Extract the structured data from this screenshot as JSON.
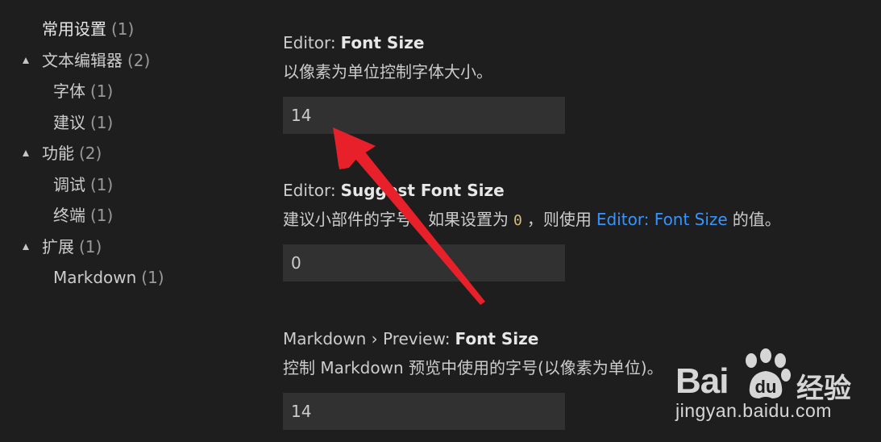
{
  "toc": {
    "items": [
      {
        "label": "常用设置",
        "count": "(1)",
        "expanded": false
      },
      {
        "label": "文本编辑器",
        "count": "(2)",
        "expanded": true
      },
      {
        "label": "字体",
        "count": "(1)"
      },
      {
        "label": "建议",
        "count": "(1)"
      },
      {
        "label": "功能",
        "count": "(2)",
        "expanded": true
      },
      {
        "label": "调试",
        "count": "(1)"
      },
      {
        "label": "终端",
        "count": "(1)"
      },
      {
        "label": "扩展",
        "count": "(1)",
        "expanded": true
      },
      {
        "label": "Markdown",
        "count": "(1)"
      }
    ]
  },
  "settings": [
    {
      "category": "Editor:",
      "key": "Font Size",
      "description": "以像素为单位控制字体大小。",
      "value": "14"
    },
    {
      "category": "Editor:",
      "key": "Suggest Font Size",
      "description_pre": "建议小部件的字号。如果设置为",
      "description_code": "0",
      "description_mid": "，则使用",
      "description_link": "Editor: Font Size",
      "description_post": "的值。",
      "value": "0"
    },
    {
      "category": "Markdown › Preview:",
      "key": "Font Size",
      "description": "控制 Markdown 预览中使用的字号(以像素为单位)。",
      "value": "14"
    }
  ],
  "watermark": {
    "brand": "Bai",
    "brand_suffix": "经验",
    "url": "jingyan.baidu.com"
  },
  "colors": {
    "background": "#1e1e1e",
    "input_background": "#313131",
    "link": "#3794ff",
    "code": "#d7ba7d",
    "annotation_arrow": "#e8202a"
  }
}
